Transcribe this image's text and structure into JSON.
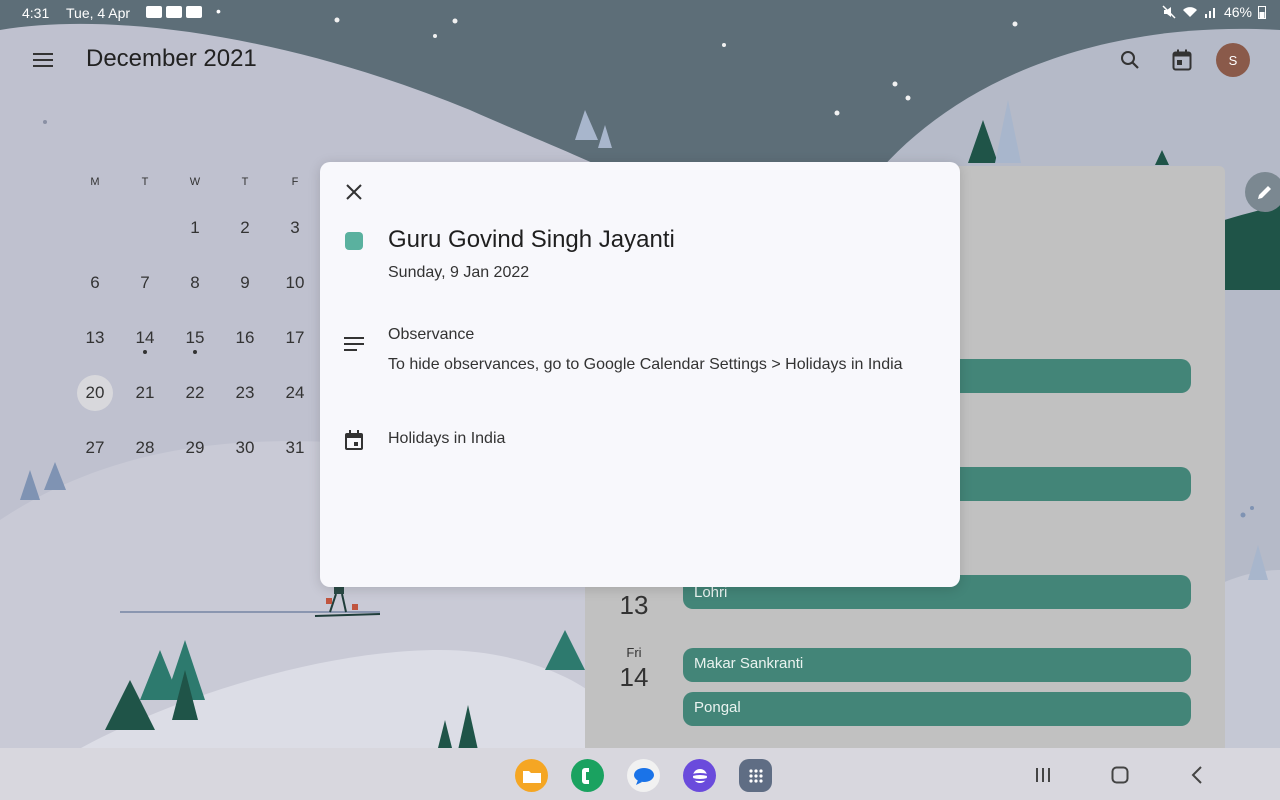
{
  "status_bar": {
    "time": "4:31",
    "date": "Tue, 4 Apr",
    "dot": "•",
    "battery": "46%"
  },
  "header": {
    "title": "December 2021"
  },
  "avatar": {
    "initial": "S"
  },
  "mini_calendar": {
    "weekdays": [
      "M",
      "T",
      "W",
      "T",
      "F"
    ],
    "rows": [
      [
        "",
        "",
        "1",
        "2",
        "3"
      ],
      [
        "6",
        "7",
        "8",
        "9",
        "10"
      ],
      [
        "13",
        "14",
        "15",
        "16",
        "17"
      ],
      [
        "20",
        "21",
        "22",
        "23",
        "24"
      ],
      [
        "27",
        "28",
        "29",
        "30",
        "31"
      ]
    ],
    "today": "20"
  },
  "schedule": {
    "day13_num": "13",
    "day14_weekday": "Fri",
    "day14_num": "14",
    "events": [
      "Lohri",
      "Makar Sankranti",
      "Pongal"
    ]
  },
  "event_dialog": {
    "title": "Guru Govind Singh Jayanti",
    "date": "Sunday, 9 Jan 2022",
    "type": "Observance",
    "description": "To hide observances, go to Google Calendar Settings > Holidays in India",
    "calendar": "Holidays in India",
    "color": "#5ab19f"
  },
  "dock": {
    "apps": [
      "files-app-icon",
      "phone-app-icon",
      "messages-app-icon",
      "internet-app-icon",
      "app-drawer-icon"
    ]
  },
  "colors": {
    "event_chip": "#438578",
    "sky": "#5d6e78"
  }
}
